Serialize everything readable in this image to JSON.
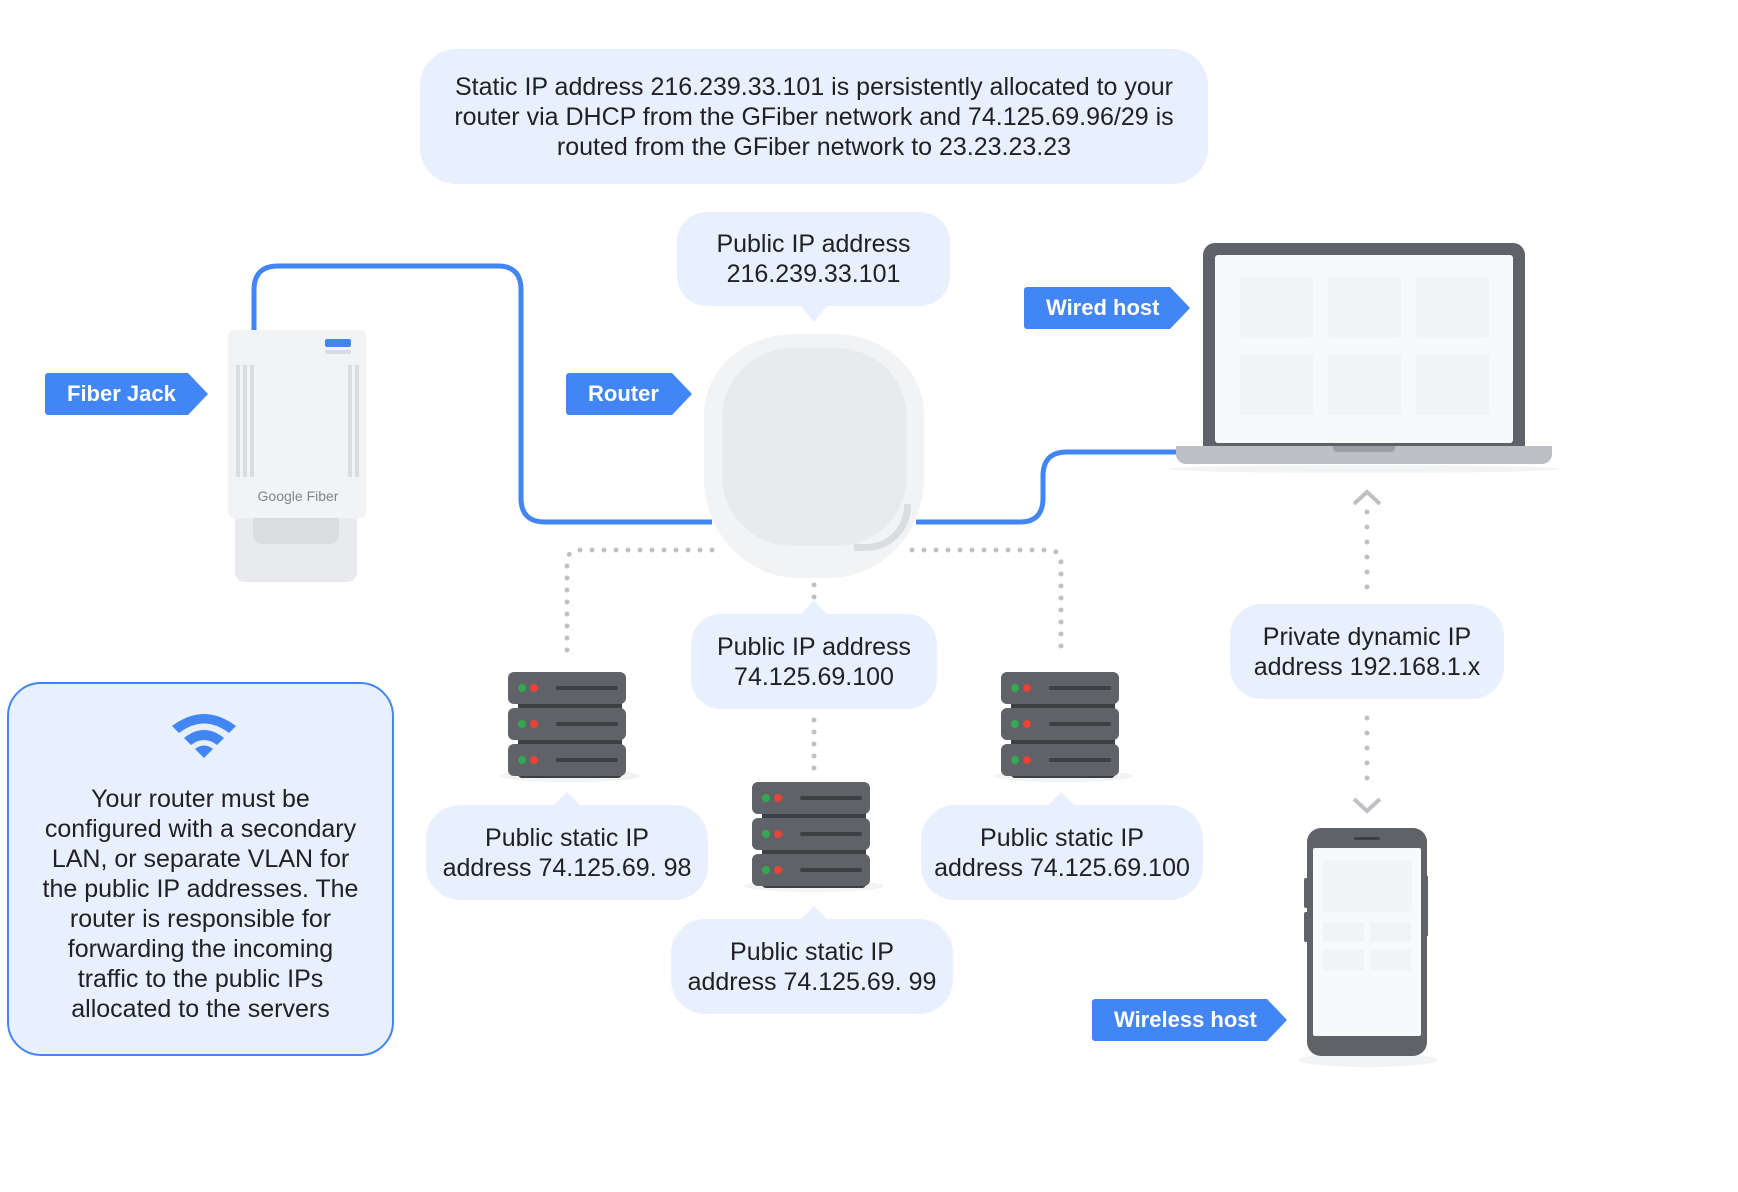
{
  "colors": {
    "accent": "#4285f4",
    "bubble_bg": "#e8f0fe",
    "device_dark": "#5f6368",
    "device_light": "#f1f3f4",
    "led_green": "#34a853",
    "led_red": "#ea4335",
    "dotted_line": "#bdc1c6"
  },
  "header_bubble": {
    "text": "Static IP address 216.239.33.101 is persistently allocated to your\nrouter via DHCP from the GFiber network and 74.125.69.96/29 is\nrouted from the GFiber network to 23.23.23.23"
  },
  "labels": {
    "fiber_jack": "Fiber Jack",
    "router": "Router",
    "wired_host": "Wired host",
    "wireless_host": "Wireless host"
  },
  "fiber_jack": {
    "brand": "Google Fiber"
  },
  "bubbles": {
    "router_public_ip": "Public IP address\n216.239.33.101",
    "lan_public_ip": "Public IP address\n74.125.69.100",
    "private_dynamic_ip": "Private dynamic IP\naddress 192.168.1.x",
    "server_left": "Public static IP\naddress 74.125.69. 98",
    "server_middle": "Public static IP\naddress 74.125.69. 99",
    "server_right": "Public static IP\naddress 74.125.69.100"
  },
  "note": {
    "icon": "wifi-icon",
    "text": "Your router must be\nconfigured with a secondary\nLAN, or separate VLAN for\nthe public IP addresses. The\nrouter is responsible for\nforwarding the incoming\ntraffic to the public IPs\nallocated to the servers"
  },
  "icons": {
    "fiber_jack": "fiber-jack-device-icon",
    "router": "router-device-icon",
    "server": "server-rack-icon",
    "laptop": "laptop-icon",
    "phone": "smartphone-icon",
    "arrow_up": "chevron-up-icon",
    "arrow_down": "chevron-down-icon"
  }
}
